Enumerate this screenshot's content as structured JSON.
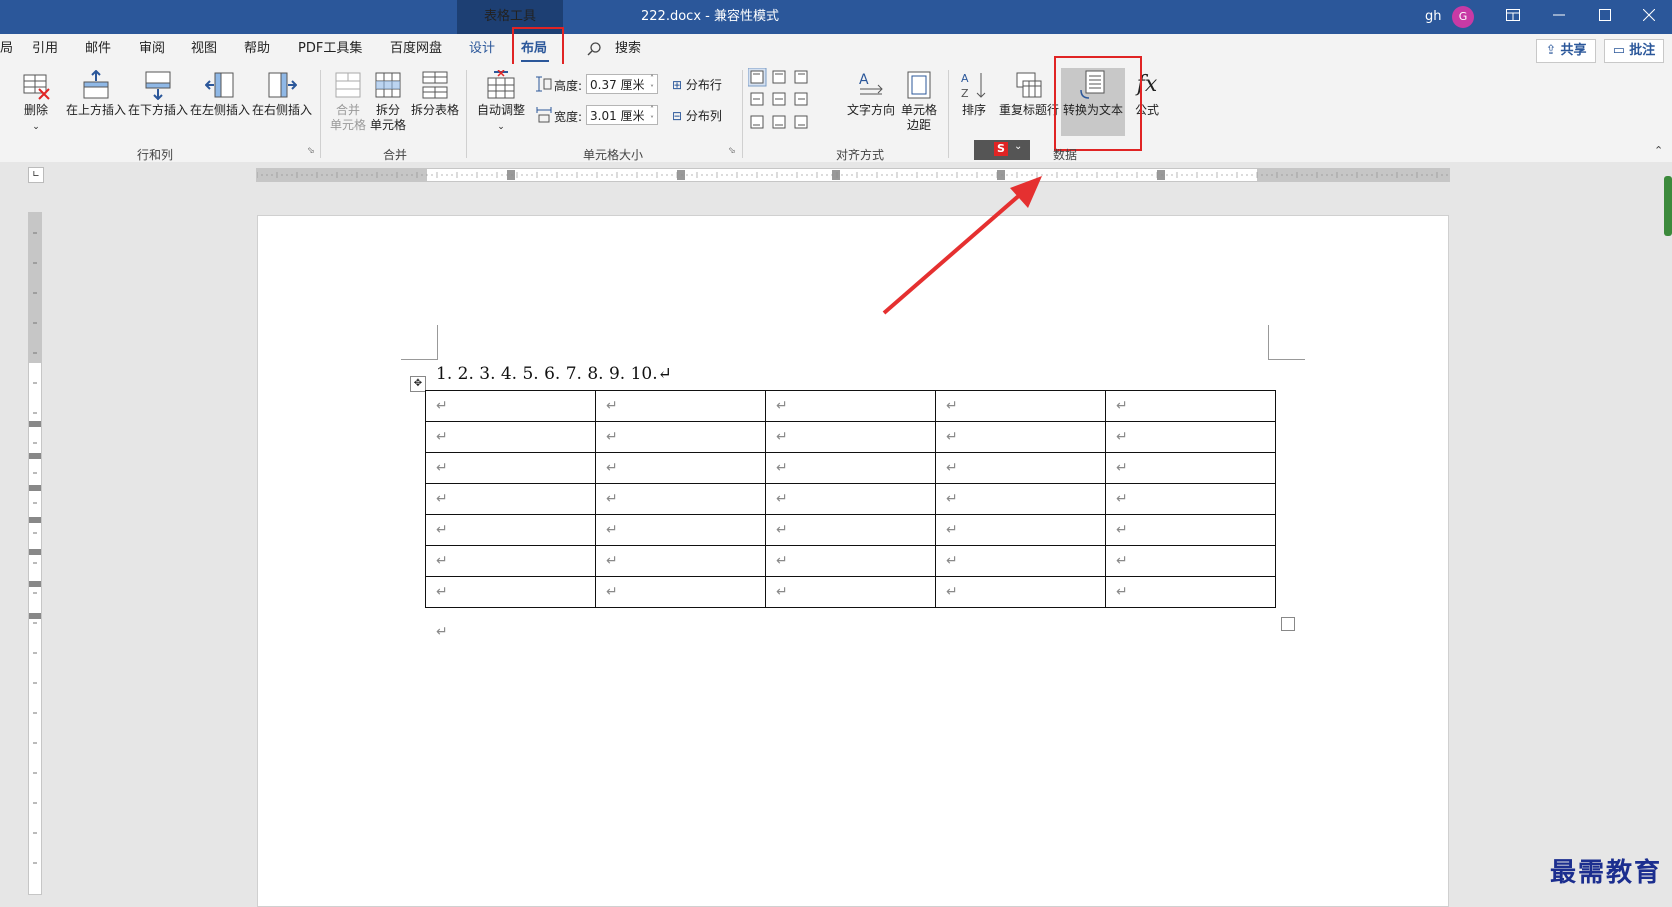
{
  "titlebar": {
    "tools_tab": "表格工具",
    "document_title": "222.docx  -  兼容性模式",
    "user_name": "gh",
    "avatar_letter": "G",
    "restore_icon": "ribbon-display-icon",
    "minimize_icon": "minimize-icon",
    "maximize_icon": "maximize-icon",
    "close_icon": "close-icon"
  },
  "tabs": {
    "cut_tab": "局",
    "items": [
      "引用",
      "邮件",
      "审阅",
      "视图",
      "帮助",
      "PDF工具集",
      "百度网盘",
      "设计",
      "布局"
    ],
    "search_label": "搜索",
    "share_label": "共享",
    "comments_label": "批注"
  },
  "ribbon": {
    "rows_cols": {
      "delete": "删除",
      "insert_above": "在上方插入",
      "insert_below": "在下方插入",
      "insert_left": "在左侧插入",
      "insert_right": "在右侧插入",
      "group_label": "行和列"
    },
    "merge": {
      "merge_cells_1": "合并",
      "merge_cells_2": "单元格",
      "split_cells_1": "拆分",
      "split_cells_2": "单元格",
      "split_table": "拆分表格",
      "group_label": "合并"
    },
    "cell_size": {
      "autofit": "自动调整",
      "height_label": "高度:",
      "height_value": "0.37 厘米",
      "width_label": "宽度:",
      "width_value": "3.01 厘米",
      "distribute_rows": "分布行",
      "distribute_cols": "分布列",
      "group_label": "单元格大小"
    },
    "alignment": {
      "text_direction": "文字方向",
      "cell_margins_1": "单元格",
      "cell_margins_2": "边距",
      "group_label": "对齐方式"
    },
    "data": {
      "sort": "排序",
      "repeat_header": "重复标题行",
      "convert_to_text": "转换为文本",
      "formula": "公式",
      "formula_glyph": "fx",
      "group_label": "数据"
    }
  },
  "document": {
    "numbers_line": "1. 2. 3. 4. 5. 6. 7. 8. 9. 10.↵",
    "paragraph_mark": "↵",
    "table_rows": 7,
    "table_cols": 5
  },
  "watermark": "最需教育",
  "colors": {
    "title_blue": "#2b579a",
    "highlight_red": "#e02424",
    "arrow_red": "#e53030"
  }
}
